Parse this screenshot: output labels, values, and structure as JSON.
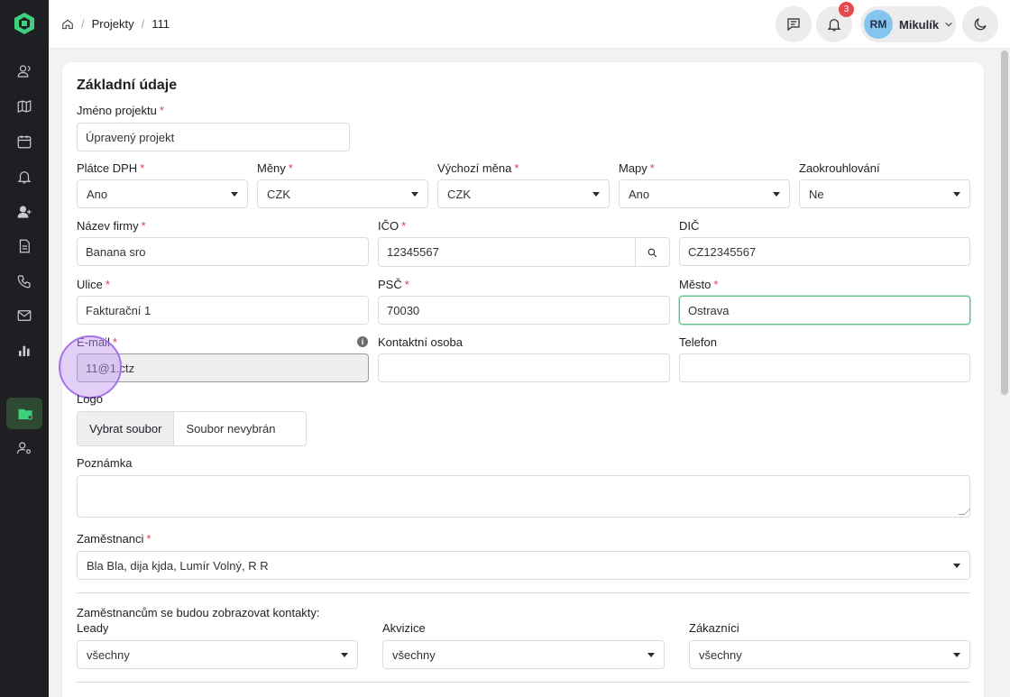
{
  "header": {
    "breadcrumb": [
      "Projekty",
      "111"
    ],
    "notification_count": "3",
    "user": {
      "initials": "RM",
      "name": "Mikulík"
    }
  },
  "form": {
    "section_title": "Základní údaje",
    "project_name": {
      "label": "Jméno projektu",
      "value": "Úpravený projekt"
    },
    "vat_payer": {
      "label": "Plátce DPH",
      "value": "Ano"
    },
    "currencies": {
      "label": "Měny",
      "value": "CZK"
    },
    "default_currency": {
      "label": "Výchozí měna",
      "value": "CZK"
    },
    "maps": {
      "label": "Mapy",
      "value": "Ano"
    },
    "rounding": {
      "label": "Zaokrouhlování",
      "value": "Ne"
    },
    "company_name": {
      "label": "Název firmy",
      "value": "Banana sro"
    },
    "ico": {
      "label": "IČO",
      "value": "12345567"
    },
    "dic": {
      "label": "DIČ",
      "value": "CZ12345567"
    },
    "street": {
      "label": "Ulice",
      "value": "Fakturační 1"
    },
    "zip": {
      "label": "PSČ",
      "value": "70030"
    },
    "city": {
      "label": "Město",
      "value": "Ostrava"
    },
    "email": {
      "label": "E-mail",
      "value": "11@1.ctz"
    },
    "contact_person": {
      "label": "Kontaktní osoba",
      "value": ""
    },
    "phone": {
      "label": "Telefon",
      "value": ""
    },
    "logo": {
      "label": "Logo",
      "button": "Vybrat soubor",
      "status": "Soubor nevybrán"
    },
    "note": {
      "label": "Poznámka"
    },
    "employees": {
      "label": "Zaměstnanci",
      "value": "Bla Bla, dija kjda, Lumír Volný, R R"
    },
    "contacts_caption": "Zaměstnancům se budou zobrazovat kontakty:",
    "leads": {
      "label": "Leady",
      "value": "všechny"
    },
    "acquisitions": {
      "label": "Akvizice",
      "value": "všechny"
    },
    "customers": {
      "label": "Zákazníci",
      "value": "všechny"
    }
  },
  "colors": {
    "accent": "#3ed07a",
    "required": "#d9434b",
    "sidebar": "#1e1f22"
  }
}
